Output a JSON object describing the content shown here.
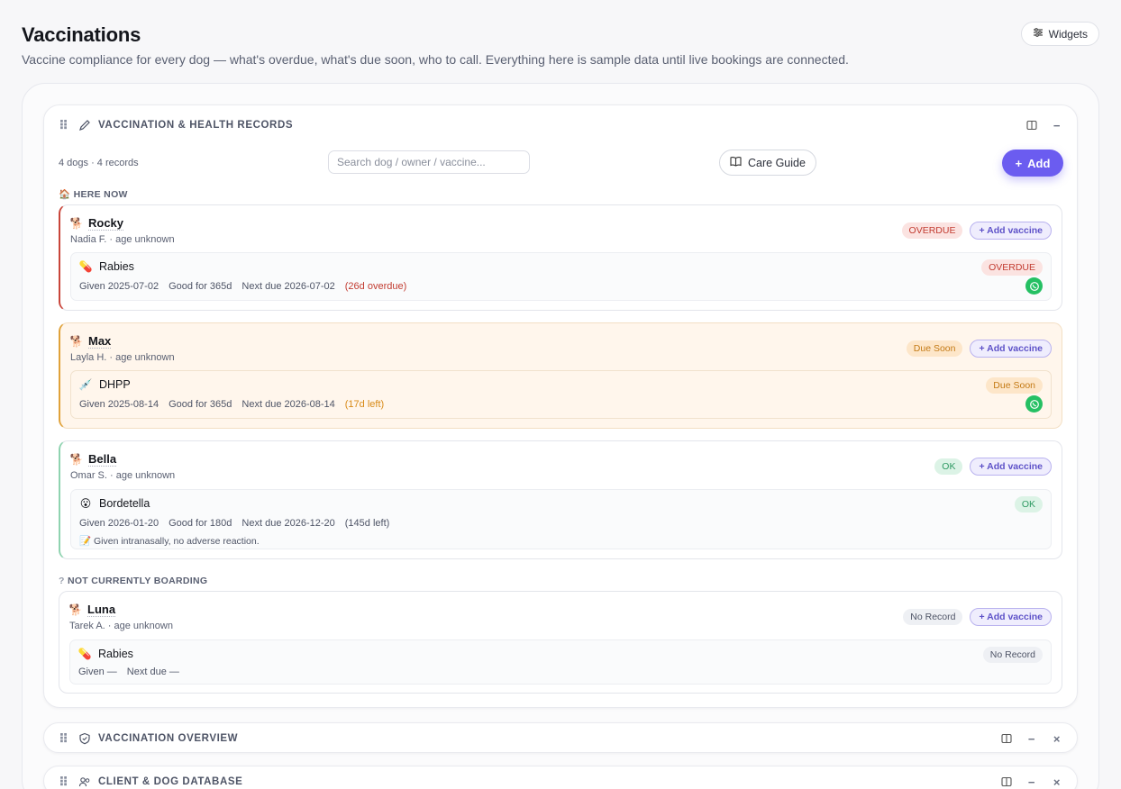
{
  "page": {
    "title": "Vaccinations",
    "subtitle": "Vaccine compliance for every dog — what's overdue, what's due soon, who to call. Everything here is sample data until live bookings are connected.",
    "widgets_label": "Widgets"
  },
  "records_card": {
    "title": "VACCINATION & HEALTH RECORDS",
    "count_text": "4 dogs · 4 records",
    "search_placeholder": "Search dog / owner / vaccine...",
    "care_guide_label": "Care Guide",
    "add_label": "Add",
    "add_vaccine_label": "Add vaccine",
    "here_now_label": "HERE NOW",
    "not_boarding_label": "NOT CURRENTLY BOARDING",
    "dogs": [
      {
        "name": "Rocky",
        "meta": "Nadia F. · age unknown",
        "status": "OVERDUE",
        "vaccine": {
          "name": "Rabies",
          "icon": "pill-icon",
          "given": "Given 2025-07-02",
          "good_for": "Good for 365d",
          "next_due": "Next due 2026-07-02",
          "remaining": "(26d overdue)",
          "status": "OVERDUE"
        }
      },
      {
        "name": "Max",
        "meta": "Layla H. · age unknown",
        "status": "Due Soon",
        "vaccine": {
          "name": "DHPP",
          "icon": "syringe-icon",
          "given": "Given 2025-08-14",
          "good_for": "Good for 365d",
          "next_due": "Next due 2026-08-14",
          "remaining": "(17d left)",
          "status": "Due Soon"
        }
      },
      {
        "name": "Bella",
        "meta": "Omar S. · age unknown",
        "status": "OK",
        "vaccine": {
          "name": "Bordetella",
          "icon": "face-icon",
          "given": "Given 2026-01-20",
          "good_for": "Good for 180d",
          "next_due": "Next due 2026-12-20",
          "remaining": "(145d left)",
          "status": "OK",
          "note": "📝 Given intranasally, no adverse reaction."
        }
      },
      {
        "name": "Luna",
        "meta": "Tarek A. · age unknown",
        "status": "No Record",
        "vaccine": {
          "name": "Rabies",
          "icon": "pill-icon",
          "given": "Given —",
          "next_due": "Next due —",
          "status": "No Record"
        }
      }
    ]
  },
  "overview_card": {
    "title": "VACCINATION OVERVIEW"
  },
  "database_card": {
    "title": "CLIENT & DOG DATABASE"
  },
  "colors": {
    "accent": "#6b5cf0",
    "overdue": "#c23b30",
    "due_soon": "#d88a17",
    "ok": "#2f9a63",
    "whatsapp": "#25c063"
  }
}
